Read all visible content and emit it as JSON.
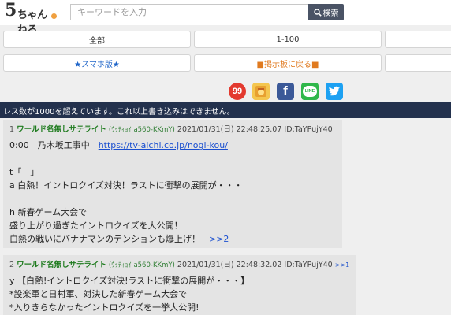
{
  "header": {
    "logo_num": "5",
    "logo_kana": "ちゃんねる",
    "search_placeholder": "キーワードを入力",
    "search_button": "検索"
  },
  "nav": {
    "all": "全部",
    "range": "1-100",
    "smartphone": "★スマホ版★",
    "back": "■掲示板に戻る■"
  },
  "share": {
    "badge_99": "99",
    "facebook": "f",
    "line": "LINE"
  },
  "notice": "レス数が1000を超えています。これ以上書き込みはできません。",
  "posts": [
    {
      "num": "1",
      "name": "ワールド名無しサテライト",
      "trip": "(ｳｯﾃｨｮｲ a560-KKmY)",
      "date": "2021/01/31(日) 22:48:25.07 ID:TaYPujY40",
      "replies": "",
      "lines": [
        {
          "prefix": "0:00　乃木坂工事中　",
          "link": "https://tv-aichi.co.jp/nogi-kou/"
        },
        {
          "text": ""
        },
        {
          "text": "t「　」"
        },
        {
          "text": "a 白熱！イントロクイズ対決！ラストに衝撃の展開が・・・"
        },
        {
          "text": ""
        },
        {
          "text": "h 新春ゲーム大会で"
        },
        {
          "text": "盛り上がり過ぎたイントロクイズを大公開！"
        },
        {
          "text": "白熱の戦いにバナナマンのテンションも爆上げ！　",
          "anchor": ">>2"
        }
      ]
    },
    {
      "num": "2",
      "name": "ワールド名無しサテライト",
      "trip": "(ｳｯﾃｨｮｲ a560-KKmY)",
      "date": "2021/01/31(日) 22:48:32.02 ID:TaYPujY40",
      "replies": ">>1",
      "lines": [
        {
          "text": "y 【白熱!イントロクイズ対決!ラストに衝撃の展開が・・・】"
        },
        {
          "text": "*設楽軍と日村軍、対決した新春ゲーム大会で"
        },
        {
          "text": "*入りきらなかったイントロクイズを一挙大公開!"
        }
      ]
    }
  ],
  "colors": {
    "notice_bg": "#23314d",
    "post_bg": "#e4e4e4",
    "name_green": "#1e7b1e",
    "link_blue": "#1a4fd0"
  }
}
